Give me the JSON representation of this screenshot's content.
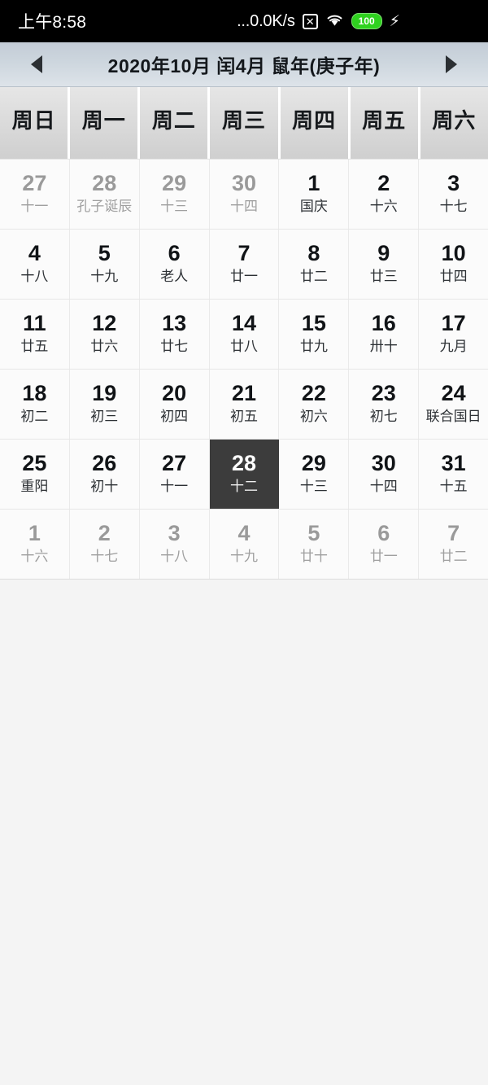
{
  "status_bar": {
    "clock": "上午8:58",
    "net_speed": "...0.0K/s",
    "no_sim_glyph": "✕",
    "battery_level": "100",
    "charging_glyph": "⚡",
    "icons": [
      "no-sim-icon",
      "wifi-icon",
      "battery-icon",
      "charging-bolt-icon"
    ],
    "background_color": "#000000"
  },
  "title_bar": {
    "prev_label": "◀",
    "next_label": "▶",
    "title": "2020年10月 闰4月 鼠年(庚子年)"
  },
  "weekdays": [
    {
      "label": "周日"
    },
    {
      "label": "周一"
    },
    {
      "label": "周二"
    },
    {
      "label": "周三"
    },
    {
      "label": "周四"
    },
    {
      "label": "周五"
    },
    {
      "label": "周六"
    }
  ],
  "calendar": {
    "selected_bg": "#3c3c3c",
    "weeks": [
      [
        {
          "solar": "27",
          "lunar": "十一",
          "other": true,
          "selected": false
        },
        {
          "solar": "28",
          "lunar": "孔子诞辰",
          "other": true,
          "selected": false
        },
        {
          "solar": "29",
          "lunar": "十三",
          "other": true,
          "selected": false
        },
        {
          "solar": "30",
          "lunar": "十四",
          "other": true,
          "selected": false
        },
        {
          "solar": "1",
          "lunar": "国庆",
          "other": false,
          "selected": false
        },
        {
          "solar": "2",
          "lunar": "十六",
          "other": false,
          "selected": false
        },
        {
          "solar": "3",
          "lunar": "十七",
          "other": false,
          "selected": false
        }
      ],
      [
        {
          "solar": "4",
          "lunar": "十八",
          "other": false,
          "selected": false
        },
        {
          "solar": "5",
          "lunar": "十九",
          "other": false,
          "selected": false
        },
        {
          "solar": "6",
          "lunar": "老人",
          "other": false,
          "selected": false
        },
        {
          "solar": "7",
          "lunar": "廿一",
          "other": false,
          "selected": false
        },
        {
          "solar": "8",
          "lunar": "廿二",
          "other": false,
          "selected": false
        },
        {
          "solar": "9",
          "lunar": "廿三",
          "other": false,
          "selected": false
        },
        {
          "solar": "10",
          "lunar": "廿四",
          "other": false,
          "selected": false
        }
      ],
      [
        {
          "solar": "11",
          "lunar": "廿五",
          "other": false,
          "selected": false
        },
        {
          "solar": "12",
          "lunar": "廿六",
          "other": false,
          "selected": false
        },
        {
          "solar": "13",
          "lunar": "廿七",
          "other": false,
          "selected": false
        },
        {
          "solar": "14",
          "lunar": "廿八",
          "other": false,
          "selected": false
        },
        {
          "solar": "15",
          "lunar": "廿九",
          "other": false,
          "selected": false
        },
        {
          "solar": "16",
          "lunar": "卅十",
          "other": false,
          "selected": false
        },
        {
          "solar": "17",
          "lunar": "九月",
          "other": false,
          "selected": false
        }
      ],
      [
        {
          "solar": "18",
          "lunar": "初二",
          "other": false,
          "selected": false
        },
        {
          "solar": "19",
          "lunar": "初三",
          "other": false,
          "selected": false
        },
        {
          "solar": "20",
          "lunar": "初四",
          "other": false,
          "selected": false
        },
        {
          "solar": "21",
          "lunar": "初五",
          "other": false,
          "selected": false
        },
        {
          "solar": "22",
          "lunar": "初六",
          "other": false,
          "selected": false
        },
        {
          "solar": "23",
          "lunar": "初七",
          "other": false,
          "selected": false
        },
        {
          "solar": "24",
          "lunar": "联合国日",
          "other": false,
          "selected": false
        }
      ],
      [
        {
          "solar": "25",
          "lunar": "重阳",
          "other": false,
          "selected": false
        },
        {
          "solar": "26",
          "lunar": "初十",
          "other": false,
          "selected": false
        },
        {
          "solar": "27",
          "lunar": "十一",
          "other": false,
          "selected": false
        },
        {
          "solar": "28",
          "lunar": "十二",
          "other": false,
          "selected": true
        },
        {
          "solar": "29",
          "lunar": "十三",
          "other": false,
          "selected": false
        },
        {
          "solar": "30",
          "lunar": "十四",
          "other": false,
          "selected": false
        },
        {
          "solar": "31",
          "lunar": "十五",
          "other": false,
          "selected": false
        }
      ],
      [
        {
          "solar": "1",
          "lunar": "十六",
          "other": true,
          "selected": false
        },
        {
          "solar": "2",
          "lunar": "十七",
          "other": true,
          "selected": false
        },
        {
          "solar": "3",
          "lunar": "十八",
          "other": true,
          "selected": false
        },
        {
          "solar": "4",
          "lunar": "十九",
          "other": true,
          "selected": false
        },
        {
          "solar": "5",
          "lunar": "廿十",
          "other": true,
          "selected": false
        },
        {
          "solar": "6",
          "lunar": "廿一",
          "other": true,
          "selected": false
        },
        {
          "solar": "7",
          "lunar": "廿二",
          "other": true,
          "selected": false
        }
      ]
    ]
  }
}
